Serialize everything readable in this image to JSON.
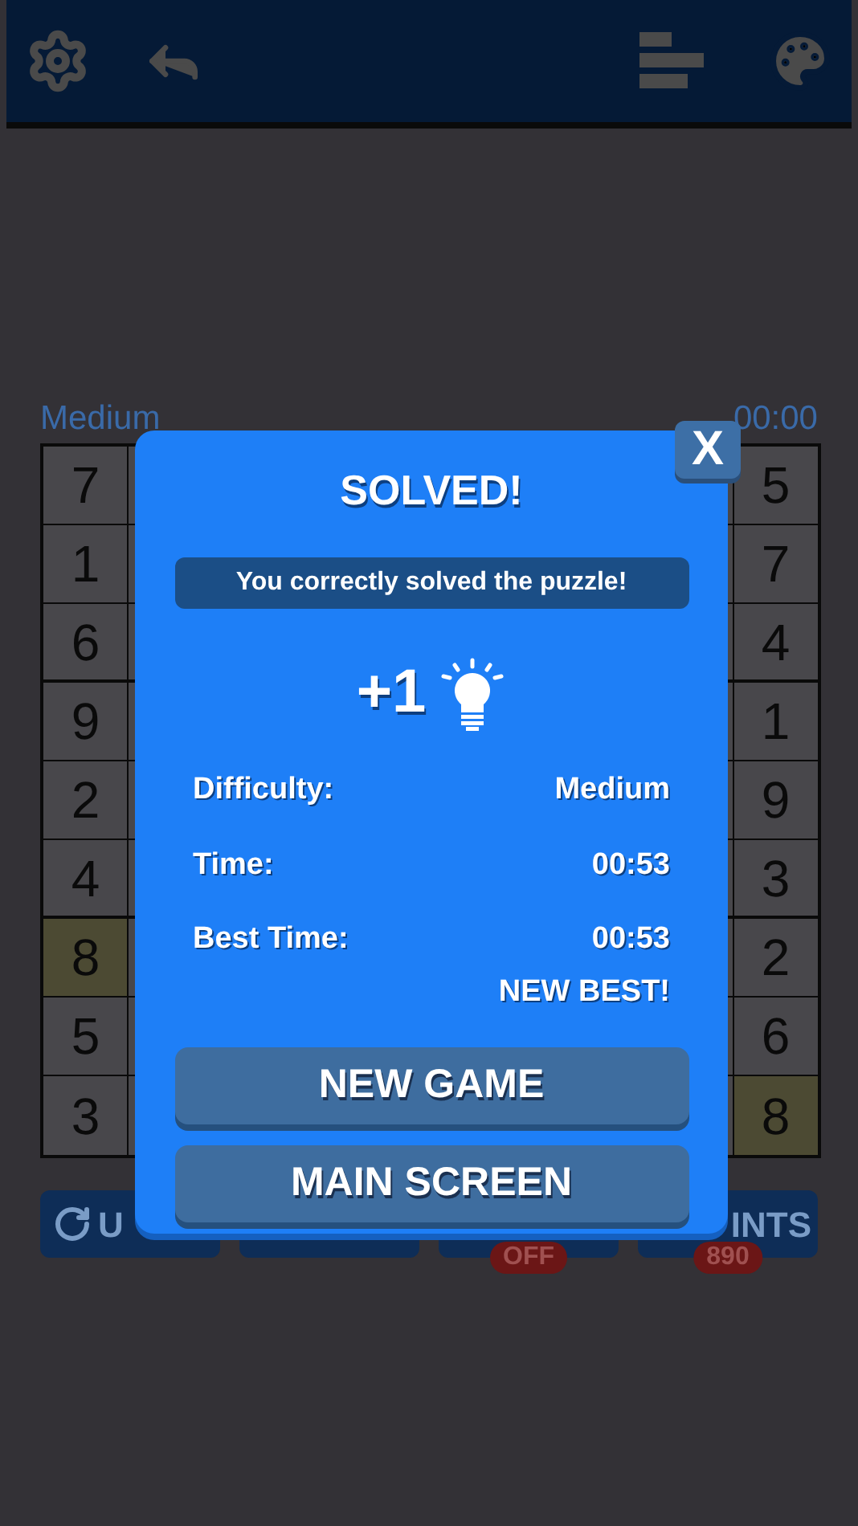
{
  "header": {
    "buttons": [
      {
        "kind": "settings"
      },
      {
        "kind": "back"
      }
    ],
    "right_buttons": [
      {
        "kind": "bars"
      },
      {
        "kind": "palette"
      }
    ]
  },
  "board": {
    "difficulty": "Medium",
    "timer": "00:00",
    "rows": [
      {
        "first": "7",
        "last": "5",
        "first_highlighted": false,
        "last_highlighted": false
      },
      {
        "first": "1",
        "last": "7",
        "first_highlighted": false,
        "last_highlighted": false
      },
      {
        "first": "6",
        "last": "4",
        "first_highlighted": false,
        "last_highlighted": false
      },
      {
        "first": "9",
        "last": "1",
        "first_highlighted": false,
        "last_highlighted": false
      },
      {
        "first": "2",
        "last": "9",
        "first_highlighted": false,
        "last_highlighted": false
      },
      {
        "first": "4",
        "last": "3",
        "first_highlighted": false,
        "last_highlighted": false
      },
      {
        "first": "8",
        "last": "2",
        "first_highlighted": true,
        "last_highlighted": false
      },
      {
        "first": "5",
        "last": "6",
        "first_highlighted": false,
        "last_highlighted": false
      },
      {
        "first": "3",
        "last": "8",
        "first_highlighted": false,
        "last_highlighted": true
      }
    ]
  },
  "toolbar": [
    {
      "kind": "undo",
      "label": "U"
    },
    {
      "kind": "erase"
    },
    {
      "kind": "notes",
      "badge": "OFF"
    },
    {
      "kind": "hints",
      "label": "INTS",
      "badge": "890"
    }
  ],
  "dialog": {
    "close": "X",
    "title": "SOLVED!",
    "message": "You correctly solved the puzzle!",
    "reward": "+1",
    "stats": [
      {
        "label": "Difficulty:",
        "value": "Medium"
      },
      {
        "label": "Time:",
        "value": "00:53"
      },
      {
        "label": "Best Time:",
        "value": "00:53",
        "note": "NEW BEST!"
      }
    ],
    "buttons": [
      "NEW GAME",
      "MAIN SCREEN"
    ]
  }
}
